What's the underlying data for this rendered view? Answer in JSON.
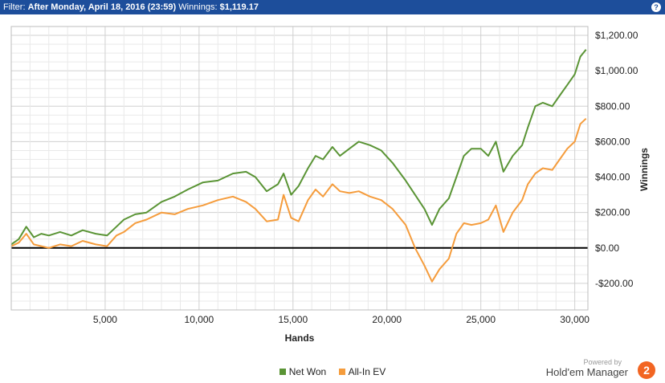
{
  "filter": {
    "label": "Filter:",
    "value": "After Monday, April 18, 2016 (23:59)",
    "winnings_label": "Winnings:",
    "winnings_value": "$1,119.17"
  },
  "help_glyph": "?",
  "brand": {
    "powered": "Powered by",
    "name": "Hold'em Manager",
    "logo": "2"
  },
  "colors": {
    "net_won": "#5a9435",
    "all_in_ev": "#f59c3c",
    "header": "#1d4e9b"
  },
  "chart_data": {
    "type": "line",
    "title": "",
    "xlabel": "Hands",
    "ylabel": "Winnings",
    "xlim": [
      0,
      30700
    ],
    "ylim": [
      -350,
      1250
    ],
    "x_ticks": [
      5000,
      10000,
      15000,
      20000,
      25000,
      30000
    ],
    "x_tick_labels": [
      "5,000",
      "10,000",
      "15,000",
      "20,000",
      "25,000",
      "30,000"
    ],
    "y_ticks": [
      -200,
      0,
      200,
      400,
      600,
      800,
      1000,
      1200
    ],
    "y_tick_labels": [
      "-$200.00",
      "$0.00",
      "$200.00",
      "$400.00",
      "$600.00",
      "$800.00",
      "$1,000.00",
      "$1,200.00"
    ],
    "grid": true,
    "legend": "bottom-center",
    "series": [
      {
        "name": "Net Won",
        "color": "#5a9435",
        "x": [
          0,
          400,
          800,
          1200,
          1600,
          2000,
          2600,
          3200,
          3800,
          4500,
          5100,
          5600,
          6000,
          6600,
          7200,
          8000,
          8700,
          9400,
          10200,
          11000,
          11800,
          12500,
          13000,
          13600,
          14200,
          14500,
          14900,
          15300,
          15800,
          16200,
          16600,
          17100,
          17500,
          18000,
          18500,
          19100,
          19700,
          20300,
          21000,
          21500,
          22000,
          22400,
          22800,
          23300,
          23700,
          24100,
          24500,
          25000,
          25400,
          25800,
          26200,
          26700,
          27200,
          27500,
          27900,
          28300,
          28800,
          29200,
          29600,
          30000,
          30300,
          30600
        ],
        "values": [
          20,
          50,
          120,
          60,
          80,
          70,
          90,
          70,
          100,
          80,
          70,
          120,
          160,
          190,
          200,
          260,
          290,
          330,
          370,
          380,
          420,
          430,
          400,
          320,
          360,
          420,
          300,
          350,
          450,
          520,
          500,
          570,
          520,
          560,
          600,
          580,
          550,
          480,
          380,
          300,
          220,
          130,
          220,
          280,
          400,
          520,
          560,
          560,
          520,
          600,
          430,
          520,
          580,
          680,
          800,
          820,
          800,
          860,
          920,
          980,
          1080,
          1120
        ]
      },
      {
        "name": "All-In EV",
        "color": "#f59c3c",
        "x": [
          0,
          400,
          800,
          1200,
          1600,
          2000,
          2600,
          3200,
          3800,
          4500,
          5100,
          5600,
          6000,
          6600,
          7200,
          8000,
          8700,
          9400,
          10200,
          11000,
          11800,
          12500,
          13000,
          13600,
          14200,
          14500,
          14900,
          15300,
          15800,
          16200,
          16600,
          17100,
          17500,
          18000,
          18500,
          19100,
          19700,
          20300,
          21000,
          21500,
          22000,
          22400,
          22800,
          23300,
          23700,
          24100,
          24500,
          25000,
          25400,
          25800,
          26200,
          26700,
          27200,
          27500,
          27900,
          28300,
          28800,
          29200,
          29600,
          30000,
          30300,
          30600
        ],
        "values": [
          10,
          30,
          80,
          20,
          10,
          0,
          20,
          10,
          40,
          20,
          10,
          70,
          90,
          140,
          160,
          200,
          190,
          220,
          240,
          270,
          290,
          260,
          220,
          150,
          160,
          300,
          170,
          150,
          270,
          330,
          290,
          360,
          320,
          310,
          320,
          290,
          270,
          220,
          130,
          0,
          -100,
          -190,
          -120,
          -60,
          80,
          140,
          130,
          140,
          160,
          240,
          90,
          200,
          270,
          360,
          420,
          450,
          440,
          500,
          560,
          600,
          700,
          730
        ]
      }
    ]
  }
}
